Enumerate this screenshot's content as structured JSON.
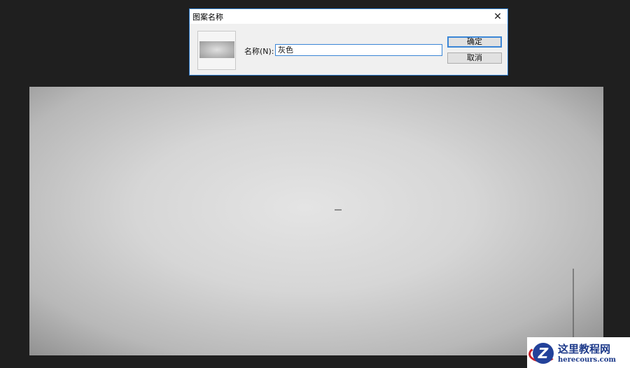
{
  "dialog": {
    "title": "图案名称",
    "name_label": "名称(N):",
    "name_value": "灰色",
    "ok_label": "确定",
    "cancel_label": "取消",
    "close_icon": "✕"
  },
  "watermark": {
    "title": "这里教程网",
    "url": "herecours.com",
    "logo_letter": "Z"
  }
}
